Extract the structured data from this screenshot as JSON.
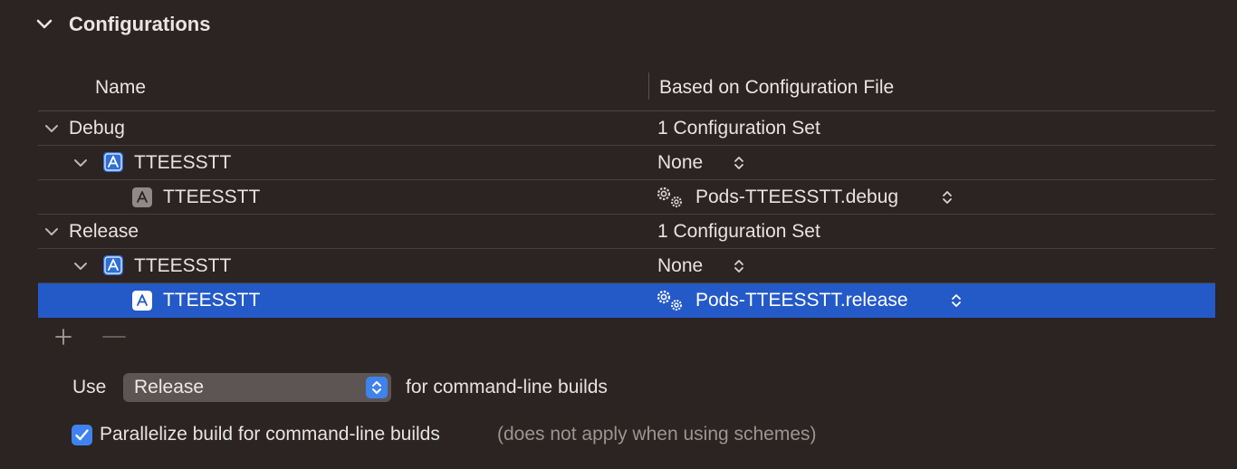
{
  "section": {
    "title": "Configurations",
    "chevron_icon": "chevron-down-icon"
  },
  "table": {
    "columns": [
      "Name",
      "Based on Configuration File"
    ],
    "rows": [
      {
        "kind": "config",
        "name": "Debug",
        "file": "1 Configuration Set"
      },
      {
        "kind": "project",
        "name": "TTEESSTT",
        "file": "None"
      },
      {
        "kind": "target",
        "name": "TTEESSTT",
        "file": "Pods-TTEESSTT.debug"
      },
      {
        "kind": "config",
        "name": "Release",
        "file": "1 Configuration Set"
      },
      {
        "kind": "project",
        "name": "TTEESSTT",
        "file": "None"
      },
      {
        "kind": "target",
        "name": "TTEESSTT",
        "file": "Pods-TTEESSTT.release",
        "selected": true
      }
    ]
  },
  "controls": {
    "add_icon": "plus-icon",
    "remove_icon": "minus-icon"
  },
  "command_line": {
    "use_label": "Use",
    "selected_config": "Release",
    "suffix": "for command-line builds"
  },
  "parallelize": {
    "checked": true,
    "label": "Parallelize build for command-line builds",
    "note": "(does not apply when using schemes)"
  },
  "colors": {
    "background": "#2b2422",
    "selection": "#2459c8",
    "accent": "#3f82f0"
  }
}
